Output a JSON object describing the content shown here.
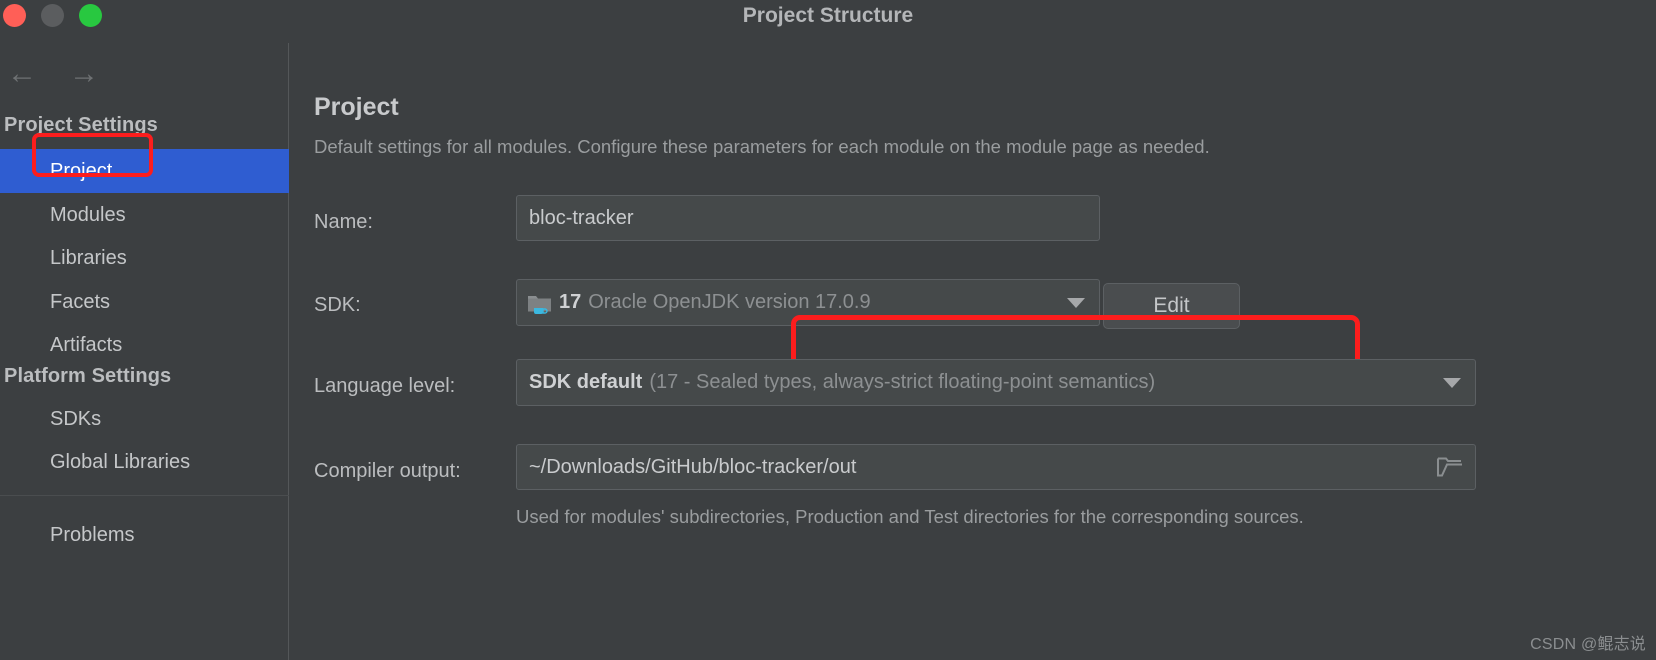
{
  "window": {
    "title": "Project Structure",
    "traffic_lights": [
      "close",
      "minimize",
      "maximize"
    ]
  },
  "sidebar": {
    "nav": {
      "back": "←",
      "forward": "→"
    },
    "groups": [
      {
        "heading": "Project Settings",
        "items": [
          {
            "label": "Project",
            "selected": true
          },
          {
            "label": "Modules",
            "selected": false
          },
          {
            "label": "Libraries",
            "selected": false
          },
          {
            "label": "Facets",
            "selected": false
          },
          {
            "label": "Artifacts",
            "selected": false
          }
        ]
      },
      {
        "heading": "Platform Settings",
        "items": [
          {
            "label": "SDKs",
            "selected": false
          },
          {
            "label": "Global Libraries",
            "selected": false
          }
        ]
      }
    ],
    "footer_items": [
      {
        "label": "Problems",
        "selected": false
      }
    ]
  },
  "main": {
    "title": "Project",
    "description": "Default settings for all modules. Configure these parameters for each module on the module page as needed.",
    "rows": {
      "name": {
        "label": "Name:",
        "value": "bloc-tracker"
      },
      "sdk": {
        "label": "SDK:",
        "icon": "jdk-folder-icon",
        "version": "17",
        "vendor": "Oracle OpenJDK version 17.0.9",
        "dropdown_icon": "chevron-down-icon",
        "edit_button": "Edit"
      },
      "language_level": {
        "label": "Language level:",
        "value": "SDK default",
        "detail": "(17 - Sealed types, always-strict floating-point semantics)",
        "dropdown_icon": "chevron-down-icon"
      },
      "compiler_output": {
        "label": "Compiler output:",
        "value": "~/Downloads/GitHub/bloc-tracker/out",
        "browse_icon": "folder-open-icon",
        "help": "Used for modules' subdirectories, Production and Test directories for the corresponding sources."
      }
    }
  },
  "annotations": {
    "color": "#fc1d1d",
    "targets": [
      "sidebar-item-project",
      "sdk-combobox"
    ]
  },
  "watermark": "CSDN @鲲志说",
  "colors": {
    "background": "#3c3f41",
    "selection": "#2f5dd1",
    "field_bg": "#45494a",
    "text_primary": "#c5c7c9",
    "text_muted": "#8d9092",
    "annotation_red": "#fc1d1d"
  }
}
